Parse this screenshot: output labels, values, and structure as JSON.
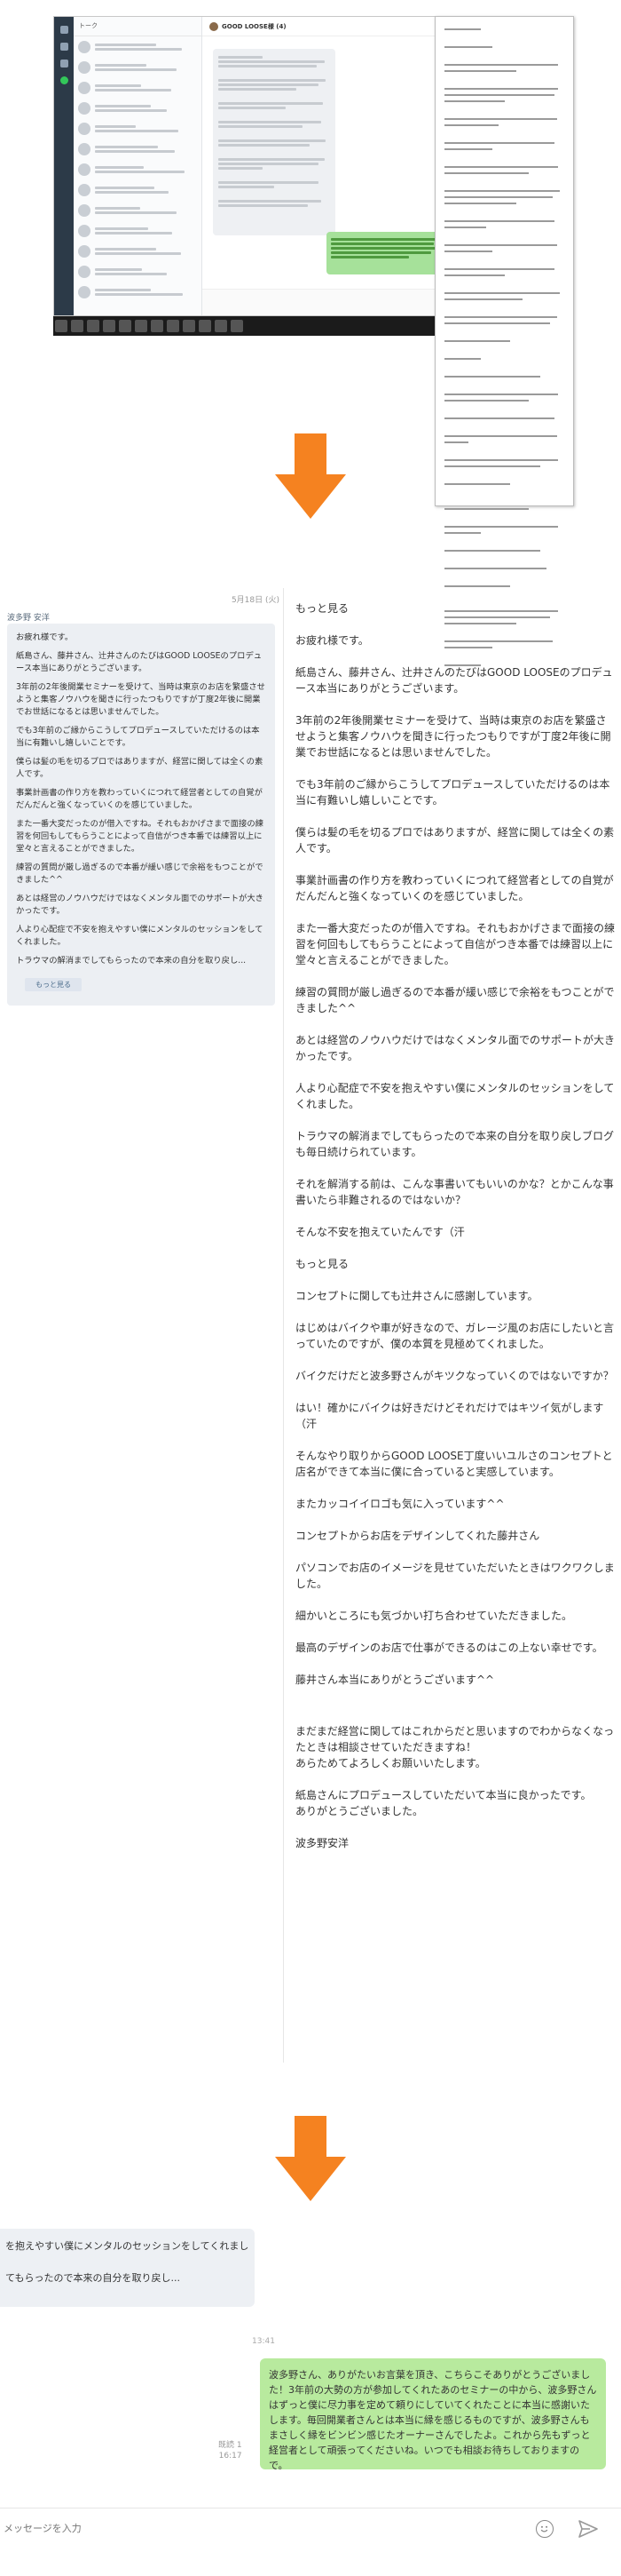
{
  "thumbnail": {
    "list_header": "トーク",
    "chat_title": "GOOD LOOSE様 (4)"
  },
  "zoomed": {
    "date": "5月18日 (火)",
    "sender": "波多野 安洋",
    "bubble_lines": [
      "お疲れ様です。",
      "紙島さん、藤井さん、辻井さんのたびはGOOD LOOSEのプロデュース本当にありがとうございます。",
      "3年前の2年後開業セミナーを受けて、当時は東京のお店を繁盛させようと集客ノウハウを聞きに行ったつもりですが丁度2年後に開業でお世話になるとは思いませんでした。",
      "でも3年前のご縁からこうしてプロデュースしていただけるのは本当に有難いし嬉しいことです。",
      "僕らは髪の毛を切るプロではありますが、経営に関しては全くの素人です。",
      "事業計画書の作り方を教わっていくにつれて経営者としての自覚がだんだんと強くなっていくのを感じていました。",
      "また一番大変だったのが借入ですね。それもおかげさまで面接の練習を何回もしてもらうことによって自信がつき本番では練習以上に堂々と言えることができました。",
      "練習の質問が厳し過ぎるので本番が緩い感じで余裕をもつことができました^^",
      "あとは経営のノウハウだけではなくメンタル面でのサポートが大きかったです。",
      "人より心配症で不安を抱えやすい僕にメンタルのセッションをしてくれました。",
      "トラウマの解消までしてもらったので本来の自分を取り戻し..."
    ],
    "more_label": "もっと見る",
    "doc_lines": [
      "もっと見る",
      "お疲れ様です。",
      "紙島さん、藤井さん、辻井さんのたびはGOOD LOOSEのプロデュース本当にありがとうございます。",
      "3年前の2年後開業セミナーを受けて、当時は東京のお店を繁盛させようと集客ノウハウを聞きに行ったつもりですが丁度2年後に開業でお世話になるとは思いませんでした。",
      "でも3年前のご縁からこうしてプロデュースしていただけるのは本当に有難いし嬉しいことです。",
      "僕らは髪の毛を切るプロではありますが、経営に関しては全くの素人です。",
      "事業計画書の作り方を教わっていくにつれて経営者としての自覚がだんだんと強くなっていくのを感じていました。",
      "また一番大変だったのが借入ですね。それもおかげさまで面接の練習を何回もしてもらうことによって自信がつき本番では練習以上に堂々と言えることができました。",
      "練習の質問が厳し過ぎるので本番が緩い感じで余裕をもつことができました^^",
      "あとは経営のノウハウだけではなくメンタル面でのサポートが大きかったです。",
      "人より心配症で不安を抱えやすい僕にメンタルのセッションをしてくれました。",
      "トラウマの解消までしてもらったので本来の自分を取り戻しブログも毎日続けられています。",
      "それを解消する前は、こんな事書いてもいいのかな？とかこんな事書いたら非難されるのではないか？",
      "そんな不安を抱えていたんです（汗",
      "もっと見る",
      "コンセプトに関しても辻井さんに感謝しています。",
      "はじめはバイクや車が好きなので、ガレージ風のお店にしたいと言っていたのですが、僕の本質を見極めてくれました。",
      "バイクだけだと波多野さんがキツクなっていくのではないですか？",
      "はい！確かにバイクは好きだけどそれだけではキツイ気がします（汗",
      "そんなやり取りからGOOD LOOSE丁度いいユルさのコンセプトと店名ができて本当に僕に合っていると実感しています。",
      "またカッコイイロゴも気に入っています^^",
      "コンセプトからお店をデザインしてくれた藤井さん",
      "パソコンでお店のイメージを見せていただいたときはワクワクしました。",
      "細かいところにも気づかい打ち合わせていただきました。",
      "最高のデザインのお店で仕事ができるのはこの上ない幸せです。",
      "藤井さん本当にありがとうございます^^",
      "まだまだ経営に関してはこれからだと思いますのでわからなくなったときは相談させていただきますね！\nあらためてよろしくお願いいたします。",
      "紙島さんにプロデュースしていただいて本当に良かったです。\nありがとうございました。",
      "波多野安洋"
    ]
  },
  "reply": {
    "prev_lines": [
      "を抱えやすい僕にメンタルのセッションをしてくれまし",
      "てもらったので本来の自分を取り戻し..."
    ],
    "time_incoming": "13:41",
    "read_label": "既読 1",
    "time_outgoing": "16:17",
    "reply_text": "波多野さん、ありがたいお言葉を頂き、こちらこそありがとうございました！3年前の大勢の方が参加してくれたあのセミナーの中から、波多野さんはずっと僕に尽力事を定めて頼りにしていてくれたことに本当に感謝いたします。毎回開業者さんとは本当に縁を感じるものですが、波多野さんもまさしく縁をビンビン感じたオーナーさんでしたよ。これから先もずっと経営者として頑張ってくださいね。いつでも相談お待ちしておりますので。",
    "input_placeholder": "メッセージを入力"
  }
}
